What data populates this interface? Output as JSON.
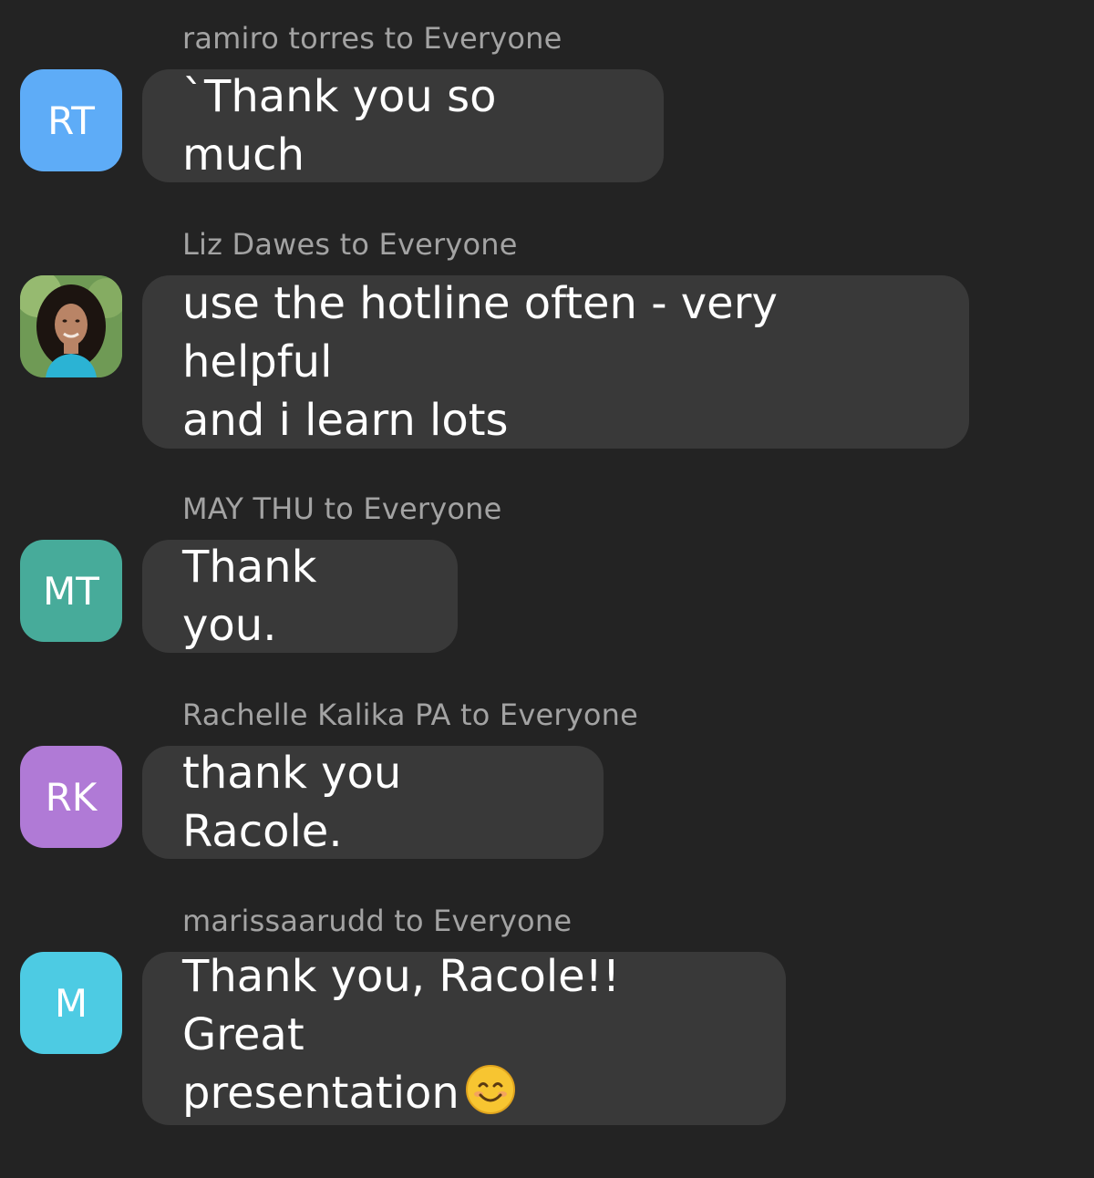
{
  "messages": [
    {
      "sender": "ramiro torres to Everyone",
      "initials": "RT",
      "avatar_color": "#5eacf7",
      "text": "`Thank you so much"
    },
    {
      "sender": "Liz Dawes to Everyone",
      "avatar_type": "photo",
      "text": "use the hotline often - very helpful\nand i learn lots"
    },
    {
      "sender": "MAY THU to Everyone",
      "initials": "MT",
      "avatar_color": "#47ab9a",
      "text": "Thank you."
    },
    {
      "sender": "Rachelle Kalika PA to Everyone",
      "initials": "RK",
      "avatar_color": "#b07ad6",
      "text": "thank you Racole."
    },
    {
      "sender": "marissaarudd to Everyone",
      "initials": "M",
      "avatar_color": "#4dcbe3",
      "text": "Thank you, Racole!! Great\npresentation",
      "emoji": "smiling-face-emoji"
    }
  ],
  "colors": {
    "background": "#232323",
    "bubble": "#393939",
    "sender_text": "#a3a3a3",
    "message_text": "#ffffff"
  }
}
